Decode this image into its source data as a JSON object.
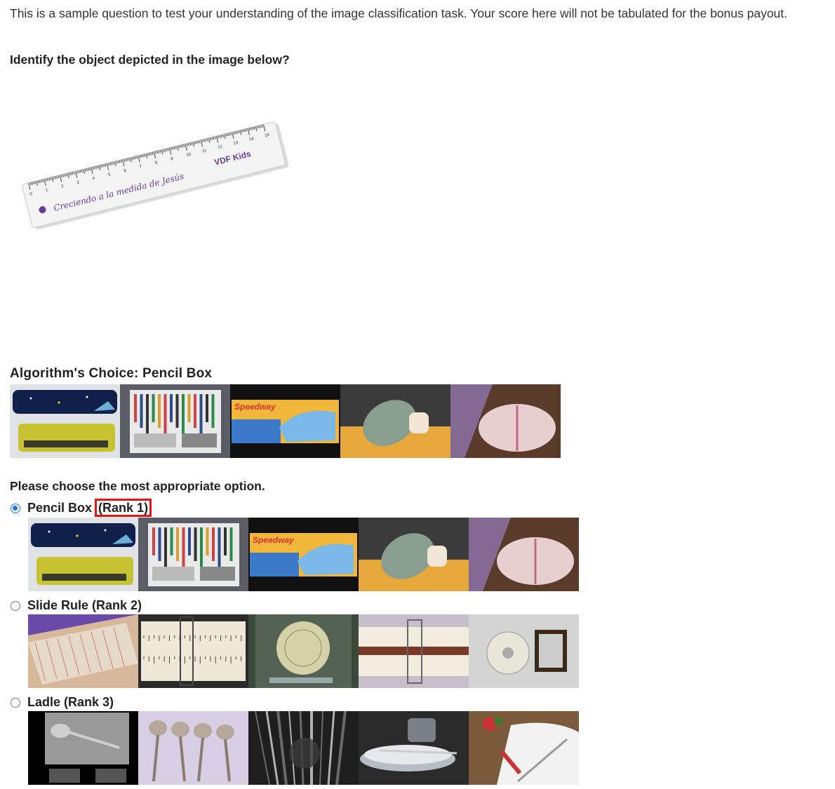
{
  "intro_text": "This is a sample question to test your understanding of the image classification task. Your score here will not be tabulated for the bonus payout.",
  "question": "Identify the object depicted in the image below?",
  "main_image": {
    "subject": "ruler",
    "ruler_text": "Creciendo a la medida de Jesús",
    "ruler_logo": "VDF Kids",
    "ticks": [
      "0",
      "1",
      "2",
      "3",
      "4",
      "5",
      "6",
      "7",
      "8",
      "9",
      "10",
      "11",
      "12",
      "13",
      "14",
      "15"
    ]
  },
  "algorithm": {
    "label": "Algorithm's Choice: Pencil Box",
    "thumbnails": [
      "pencil-box-tins",
      "pencil-case-open",
      "speedway-pencil-box",
      "zipper-pencil-pouch",
      "fabric-pencil-pouch"
    ]
  },
  "prompt": "Please choose the most appropriate option.",
  "options": [
    {
      "name": "Pencil Box",
      "rank": "(Rank 1)",
      "selected": true,
      "highlight_color": "#e11111",
      "thumbnails": [
        "pencil-box-tins",
        "pencil-case-open",
        "speedway-pencil-box",
        "zipper-pencil-pouch",
        "fabric-pencil-pouch"
      ]
    },
    {
      "label": "Slide Rule (Rank 2)",
      "selected": false,
      "thumbnails": [
        "clear-slide-rule",
        "slide-rule-closeup",
        "circular-slide-rule",
        "slide-rule-wood",
        "circular-rule-plaque"
      ]
    },
    {
      "label": "Ladle (Rank 3)",
      "selected": false,
      "thumbnails": [
        "ladle-on-grey",
        "silver-ladles",
        "kitchen-utensils",
        "plates-ladle",
        "ladle-on-towel"
      ]
    }
  ],
  "colors": {
    "radio_selected": "#1a73e8",
    "rank_highlight": "#e11111"
  }
}
